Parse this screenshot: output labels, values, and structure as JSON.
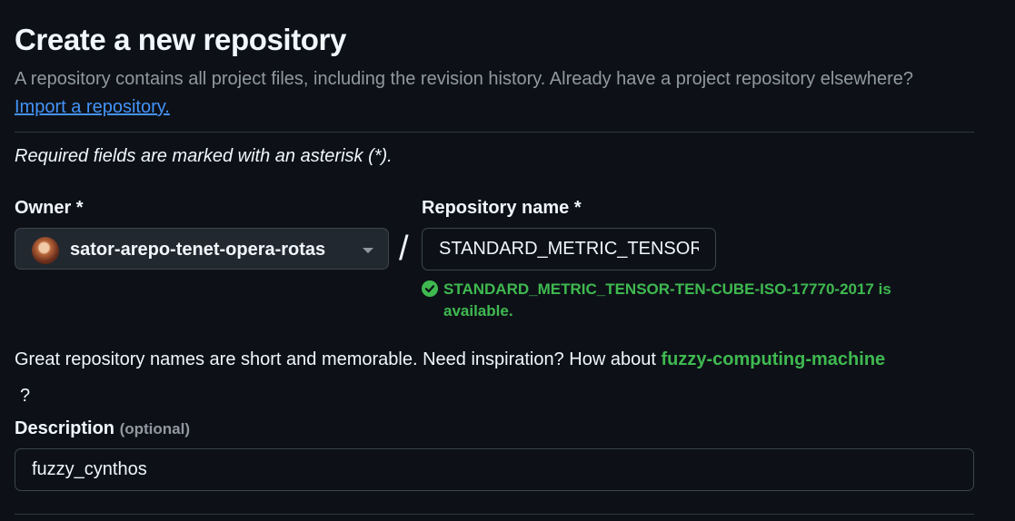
{
  "header": {
    "title": "Create a new repository",
    "subtitle_text": "A repository contains all project files, including the revision history. Already have a project repository elsewhere?",
    "import_link": "Import a repository."
  },
  "form": {
    "required_note": "Required fields are marked with an asterisk (*).",
    "owner": {
      "label": "Owner *",
      "selected": "sator-arepo-tenet-opera-rotas"
    },
    "separator": "/",
    "repository_name": {
      "label": "Repository name *",
      "value": "STANDARD_METRIC_TENSOR-TEN-CUBE-ISO-17770-2017",
      "availability": "STANDARD_METRIC_TENSOR-TEN-CUBE-ISO-17770-2017 is available."
    },
    "suggestion": {
      "text": "Great repository names are short and memorable. Need inspiration? How about",
      "name": "fuzzy-computing-machine",
      "end": "?"
    },
    "description": {
      "label": "Description",
      "optional": "(optional)",
      "value": "fuzzy_cynthos"
    }
  },
  "colors": {
    "background": "#0d1117",
    "success": "#3fb950",
    "link": "#4493f8",
    "muted": "#9198a1"
  },
  "icons": {
    "availability": "check-circle-fill-icon",
    "owner_dropdown": "triangle-down-icon"
  }
}
